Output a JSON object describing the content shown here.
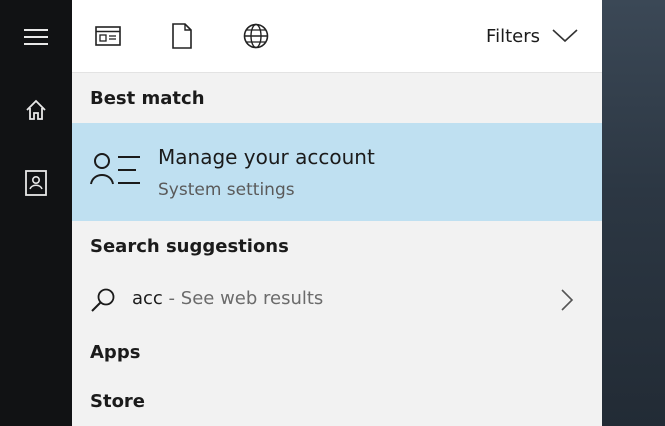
{
  "rail": {
    "items": [
      {
        "icon": "menu-icon"
      },
      {
        "icon": "home-icon"
      },
      {
        "icon": "notebook-icon"
      }
    ]
  },
  "toolbar": {
    "icons": [
      "apps-icon",
      "documents-icon",
      "web-icon"
    ],
    "filters_label": "Filters",
    "filters_icon": "chevron-down-icon"
  },
  "best_match": {
    "heading": "Best match",
    "title": "Manage your account",
    "subtitle": "System settings",
    "icon": "account-settings-icon",
    "highlight_color": "#bfe0f1"
  },
  "search_suggestions": {
    "heading": "Search suggestions",
    "items": [
      {
        "query": "acc",
        "suffix": " - See web results",
        "icon": "search-icon",
        "chevron": "chevron-right-icon"
      }
    ]
  },
  "sections": {
    "apps": "Apps",
    "store": "Store"
  }
}
